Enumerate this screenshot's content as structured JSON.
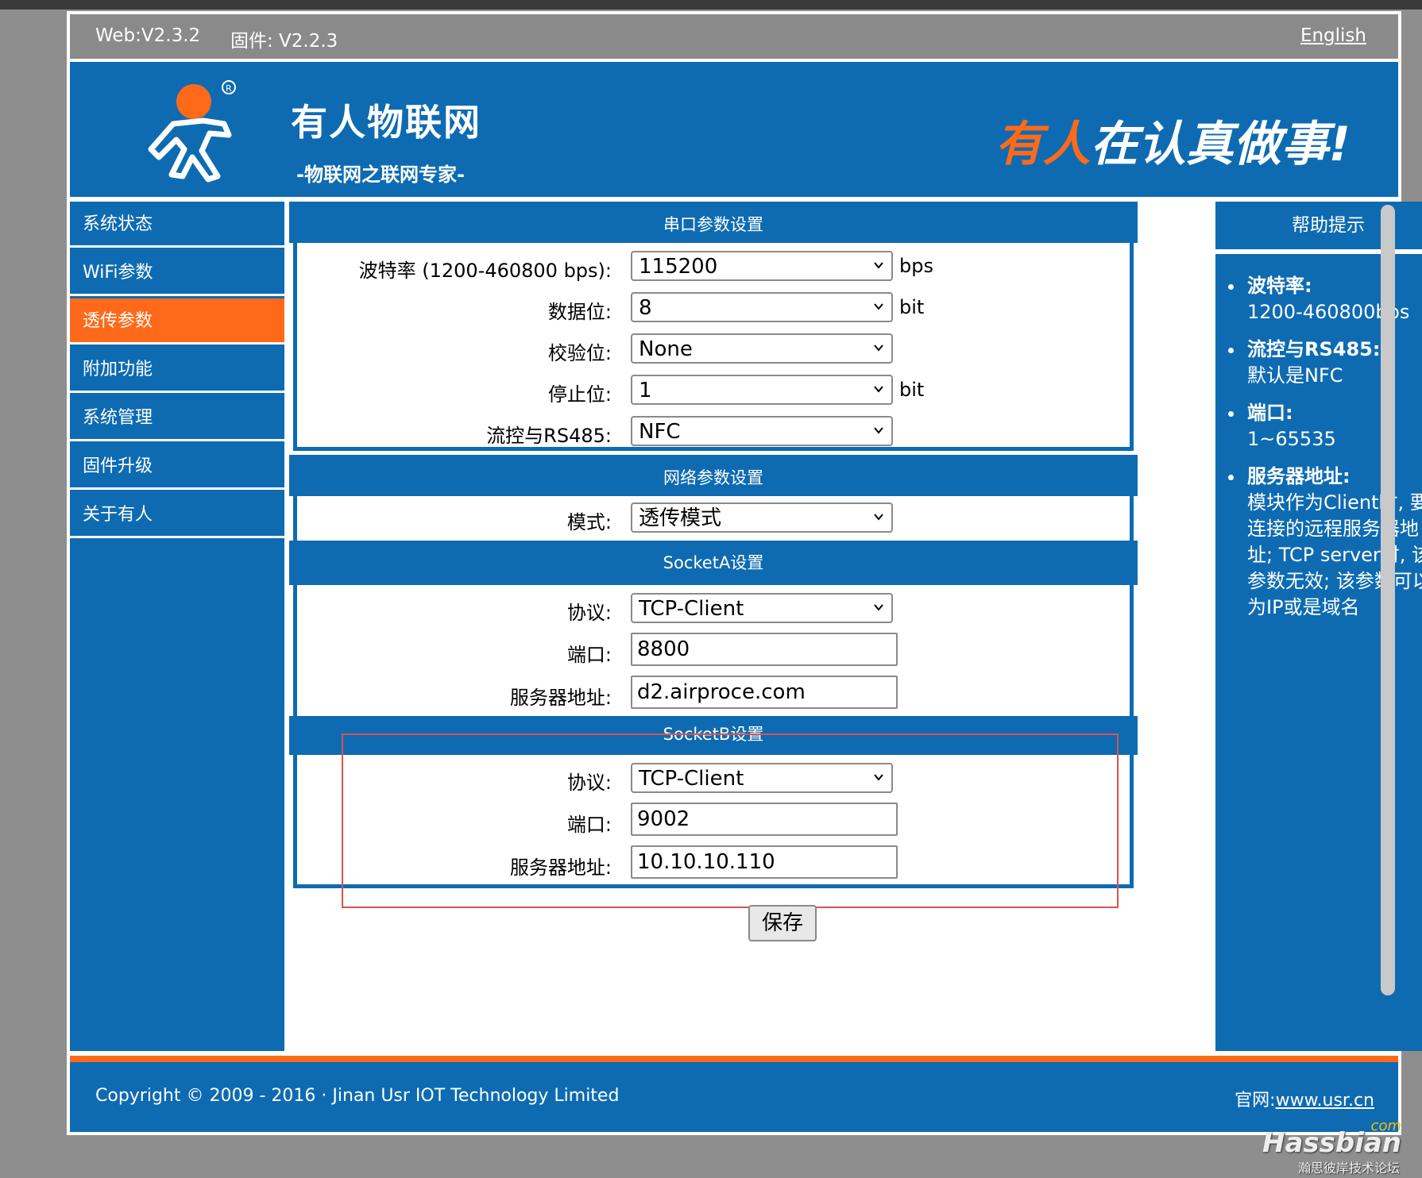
{
  "version_bar": {
    "web_version": "Web:V2.3.2",
    "firmware_version": "固件: V2.2.3",
    "language_link": "English"
  },
  "header": {
    "brand": "有人物联网",
    "tagline": "-物联网之联网专家-",
    "slogan_part1": "有人",
    "slogan_part2": "在认真做事!",
    "logo_icon": "running-man-logo-icon",
    "colors": {
      "primary": "#0e6bb2",
      "accent": "#ff6a1a"
    }
  },
  "sidebar": {
    "items": [
      {
        "label": "系统状态",
        "active": false
      },
      {
        "label": "WiFi参数",
        "active": false
      },
      {
        "label": "透传参数",
        "active": true
      },
      {
        "label": "附加功能",
        "active": false
      },
      {
        "label": "系统管理",
        "active": false
      },
      {
        "label": "固件升级",
        "active": false
      },
      {
        "label": "关于有人",
        "active": false
      }
    ]
  },
  "serial": {
    "title": "串口参数设置",
    "baud_label": "波特率 (1200-460800 bps):",
    "baud_value": "115200",
    "baud_unit": "bps",
    "databits_label": "数据位:",
    "databits_value": "8",
    "databits_unit": "bit",
    "parity_label": "校验位:",
    "parity_value": "None",
    "stopbits_label": "停止位:",
    "stopbits_value": "1",
    "stopbits_unit": "bit",
    "flow_label": "流控与RS485:",
    "flow_value": "NFC"
  },
  "network": {
    "title": "网络参数设置",
    "mode_label": "模式:",
    "mode_value": "透传模式"
  },
  "socket_a": {
    "title": "SocketA设置",
    "protocol_label": "协议:",
    "protocol_value": "TCP-Client",
    "port_label": "端口:",
    "port_value": "8800",
    "server_label": "服务器地址:",
    "server_value": "d2.airproce.com"
  },
  "socket_b": {
    "title": "SocketB设置",
    "protocol_label": "协议:",
    "protocol_value": "TCP-Client",
    "port_label": "端口:",
    "port_value": "9002",
    "server_label": "服务器地址:",
    "server_value": "10.10.10.110"
  },
  "save_label": "保存",
  "help": {
    "title": "帮助提示",
    "items": [
      {
        "title": "波特率:",
        "text": "1200-460800bps"
      },
      {
        "title": "流控与RS485:",
        "text": "默认是NFC"
      },
      {
        "title": "端口:",
        "text": "1~65535"
      },
      {
        "title": "服务器地址:",
        "text": "模块作为Client时, 要连接的远程服务器地址; TCP server时, 该参数无效; 该参数可以为IP或是域名"
      }
    ]
  },
  "footer": {
    "copyright": "Copyright © 2009 - 2016 · Jinan Usr IOT Technology Limited",
    "site_label": "官网:",
    "site_link": "www.usr.cn"
  },
  "watermark": {
    "com": "com",
    "main": "Hassbian",
    "sub": "瀚思彼岸技术论坛"
  }
}
